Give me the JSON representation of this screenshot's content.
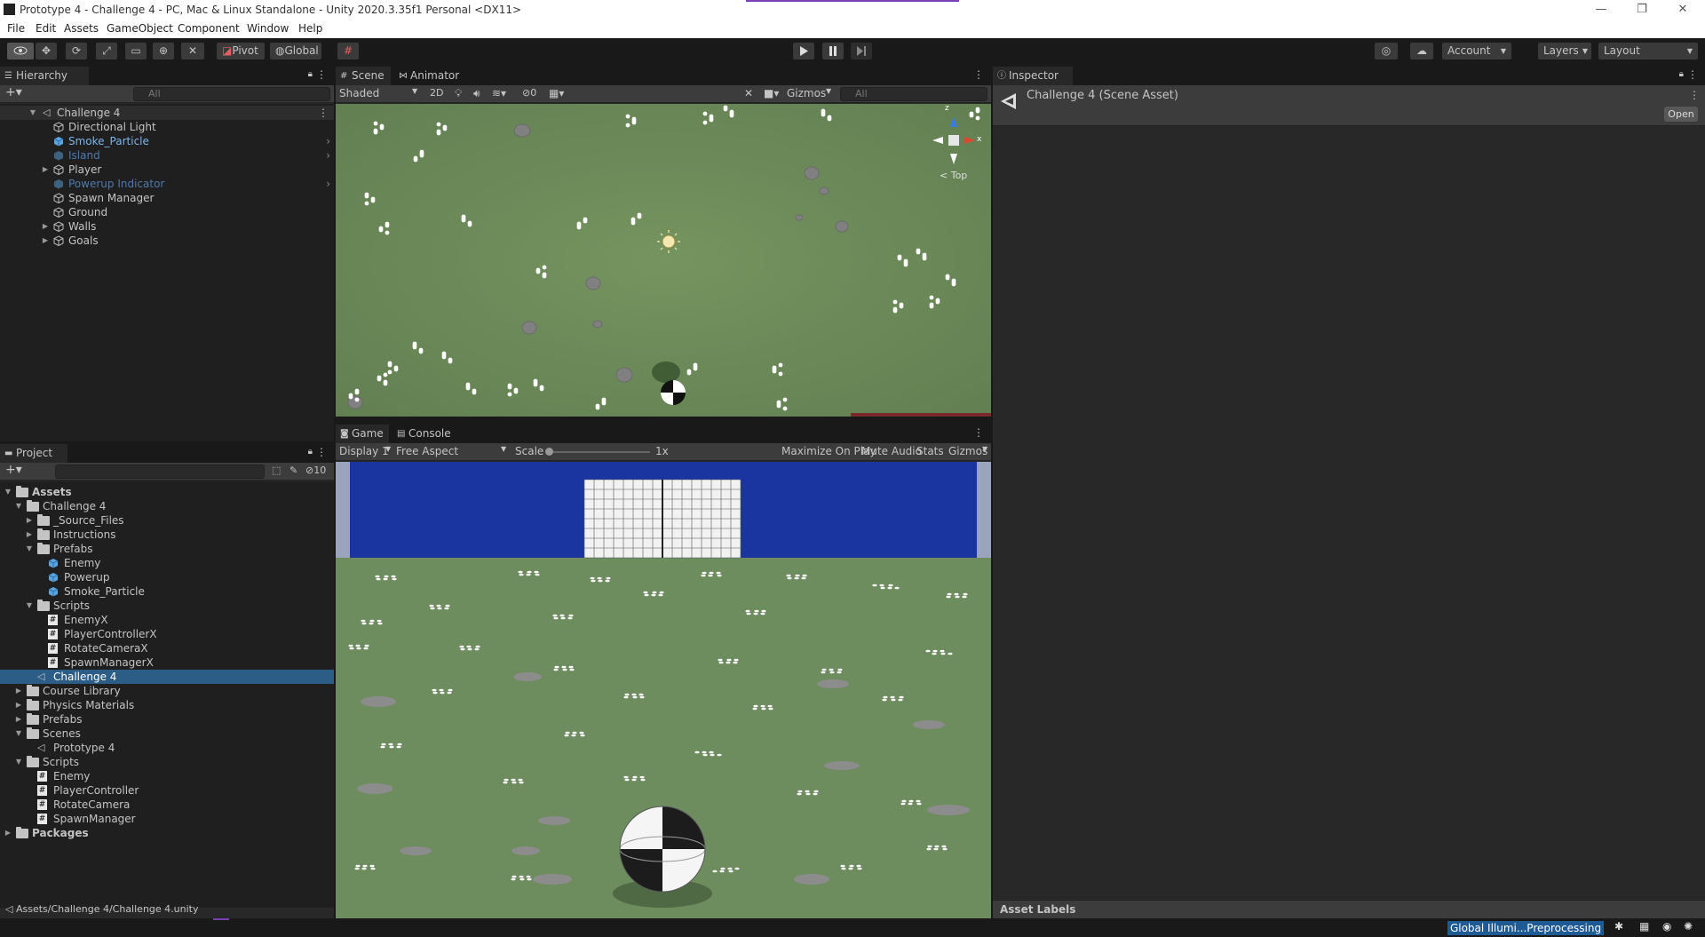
{
  "window": {
    "title": "Prototype 4 - Challenge 4 - PC, Mac & Linux Standalone - Unity 2020.3.35f1 Personal <DX11>",
    "minimize": "—",
    "restore": "❐",
    "close": "✕"
  },
  "menu": [
    "File",
    "Edit",
    "Assets",
    "GameObject",
    "Component",
    "Window",
    "Help"
  ],
  "toolbar": {
    "pivot_label": "Pivot",
    "global_label": "Global",
    "account_label": "Account",
    "layers_label": "Layers",
    "layout_label": "Layout"
  },
  "hierarchy": {
    "tab_label": "Hierarchy",
    "search_placeholder": "All",
    "scene_name": "Challenge 4",
    "items": [
      {
        "label": "Directional Light"
      },
      {
        "label": "Smoke_Particle"
      },
      {
        "label": "Island"
      },
      {
        "label": "Player"
      },
      {
        "label": "Powerup Indicator"
      },
      {
        "label": "Spawn Manager"
      },
      {
        "label": "Ground"
      },
      {
        "label": "Walls"
      },
      {
        "label": "Goals"
      }
    ]
  },
  "scene_view": {
    "tab_scene": "Scene",
    "tab_animator": "Animator",
    "shading_mode": "Shaded",
    "mode_2d": "2D",
    "hidden_count": "0",
    "gizmos_label": "Gizmos",
    "search_placeholder": "All",
    "orientation_label": "< Top",
    "axis_x": "x",
    "axis_z": "z"
  },
  "game_view": {
    "tab_game": "Game",
    "tab_console": "Console",
    "display": "Display 1",
    "aspect": "Free Aspect",
    "scale_label": "Scale",
    "scale_value": "1x",
    "maximize_label": "Maximize On Play",
    "mute_label": "Mute Audio",
    "stats_label": "Stats",
    "gizmos_label": "Gizmos"
  },
  "inspector": {
    "tab_label": "Inspector",
    "asset_title": "Challenge 4 (Scene Asset)",
    "open_label": "Open",
    "asset_labels": "Asset Labels"
  },
  "project": {
    "tab_label": "Project",
    "hidden_count": "10",
    "tree": [
      {
        "label": "Assets",
        "icon": "folder"
      },
      {
        "label": "Challenge 4",
        "icon": "folder"
      },
      {
        "label": "_Source_Files",
        "icon": "folder"
      },
      {
        "label": "Instructions",
        "icon": "folder"
      },
      {
        "label": "Prefabs",
        "icon": "folder"
      },
      {
        "label": "Enemy",
        "icon": "prefab"
      },
      {
        "label": "Powerup",
        "icon": "prefab"
      },
      {
        "label": "Smoke_Particle",
        "icon": "prefab"
      },
      {
        "label": "Scripts",
        "icon": "folder"
      },
      {
        "label": "EnemyX",
        "icon": "script"
      },
      {
        "label": "PlayerControllerX",
        "icon": "script"
      },
      {
        "label": "RotateCameraX",
        "icon": "script"
      },
      {
        "label": "SpawnManagerX",
        "icon": "script"
      },
      {
        "label": "Challenge 4",
        "icon": "scene"
      },
      {
        "label": "Course Library",
        "icon": "folder"
      },
      {
        "label": "Physics Materials",
        "icon": "folder"
      },
      {
        "label": "Prefabs",
        "icon": "folder"
      },
      {
        "label": "Scenes",
        "icon": "folder"
      },
      {
        "label": "Prototype 4",
        "icon": "scene"
      },
      {
        "label": "Scripts",
        "icon": "folder"
      },
      {
        "label": "Enemy",
        "icon": "script"
      },
      {
        "label": "PlayerController",
        "icon": "script"
      },
      {
        "label": "RotateCamera",
        "icon": "script"
      },
      {
        "label": "SpawnManager",
        "icon": "script"
      },
      {
        "label": "Packages",
        "icon": "folder"
      }
    ],
    "path": "Assets/Challenge 4/Challenge 4.unity"
  },
  "status": {
    "progress_label": "Global Illumi...Preprocessing"
  },
  "colors": {
    "selection": "#2c5d87",
    "ground": "#6f8f5c",
    "wall_blue": "#1a35a0",
    "progress": "#1e5a94"
  }
}
